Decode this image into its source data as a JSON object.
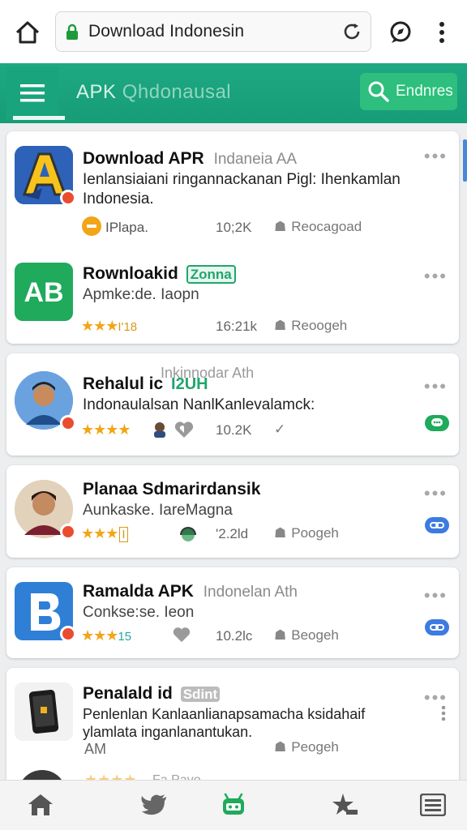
{
  "browser": {
    "url": "Download Indonesin"
  },
  "header": {
    "brand_main": "APK",
    "brand_sub": "Qhdonausal",
    "search_label": "Endnres"
  },
  "apps": [
    {
      "title": "Download APR",
      "title_extra": "Indaneia AA",
      "description": "Ienlansiaiani ringannackanan Pigl: Ihenkamlan Indonesia.",
      "rating": "",
      "rating_text": "IPlapa.",
      "size": "10;2K",
      "related": "Reocagoad",
      "icon": "letter-a-icon"
    },
    {
      "title": "Rownloakid",
      "title_tag": "Zonna",
      "description": "Apmke:de. Iaopn",
      "rating": "★★★",
      "rating_text": "I'18",
      "size": "16:21k",
      "related": "Reoogeh",
      "icon": "letters-ab-icon"
    },
    {
      "title": "Rehalul ic",
      "title_tag": "I2UH",
      "title_ghost": "Inkinnodar Ath",
      "description": "Indonaulalsan NanlKanlevalamck:",
      "rating": "★★★★",
      "size": "10.2K",
      "related": "✓",
      "icon": "person-avatar-icon"
    },
    {
      "title": "Planaa Sdmarirdansik",
      "description": "Aunkaske. IareMagna",
      "rating": "★★★",
      "rating_text": "I",
      "size": "'2.2ld",
      "related": "Poogeh",
      "icon": "person-avatar-icon"
    },
    {
      "title": "Ramalda APK",
      "title_ghost": "Indonelan Ath",
      "description": "Conkse:se. Ieon",
      "rating": "★★★",
      "rating_text": "15",
      "size": "10.2lc",
      "related": "Beogeh",
      "icon": "letter-b-icon"
    },
    {
      "title": "Penalald id",
      "title_tag": "Sdint",
      "description": "Penlenlan Kanlaanlianapsamacha ksidahaif ylamlata inganlanantukan.",
      "rating_text": "AM",
      "related": "Peogeh",
      "icon": "phone-device-icon"
    }
  ],
  "partial_row": {
    "text": "Fa Pavo"
  },
  "colors": {
    "header_green": "#1ea882",
    "search_green": "#2ebe7d",
    "star_yellow": "#f2a516",
    "badge_red": "#ea4c2e",
    "pill_green": "#1faa5c",
    "pill_blue": "#3c7be0"
  },
  "bottom_nav": [
    "home-icon",
    "twitter-bird-icon",
    "android-robot-icon",
    "star-sparkle-icon",
    "list-icon"
  ]
}
